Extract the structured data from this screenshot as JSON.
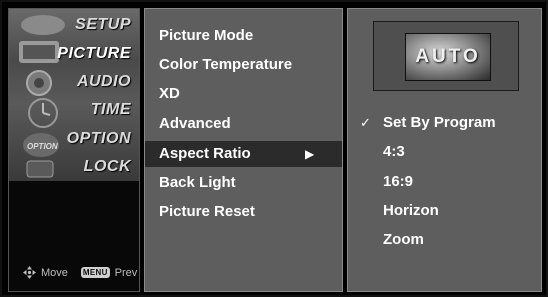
{
  "categories": [
    {
      "label": "SETUP",
      "active": false
    },
    {
      "label": "PICTURE",
      "active": true
    },
    {
      "label": "AUDIO",
      "active": false
    },
    {
      "label": "TIME",
      "active": false
    },
    {
      "label": "OPTION",
      "active": false
    },
    {
      "label": "LOCK",
      "active": false
    }
  ],
  "hints": {
    "move_label": "Move",
    "menu_key": "MENU",
    "prev_label": "Prev"
  },
  "menu": {
    "items": [
      {
        "label": "Picture Mode"
      },
      {
        "label": "Color Temperature"
      },
      {
        "label": "XD"
      },
      {
        "label": "Advanced"
      },
      {
        "label": "Aspect Ratio",
        "selected": true,
        "has_submenu": true
      },
      {
        "label": "Back Light"
      },
      {
        "label": "Picture Reset"
      }
    ],
    "submenu_arrow": "▶"
  },
  "options": {
    "preview_text": "AUTO",
    "items": [
      {
        "label": "Set By Program",
        "checked": true
      },
      {
        "label": "4:3",
        "checked": false
      },
      {
        "label": "16:9",
        "checked": false
      },
      {
        "label": "Horizon",
        "checked": false
      },
      {
        "label": "Zoom",
        "checked": false
      }
    ],
    "check_glyph": "✓"
  },
  "colors": {
    "panel_bg": "#5e5e5e",
    "selected_bg": "#2b2b2b",
    "text": "#ffffff"
  }
}
